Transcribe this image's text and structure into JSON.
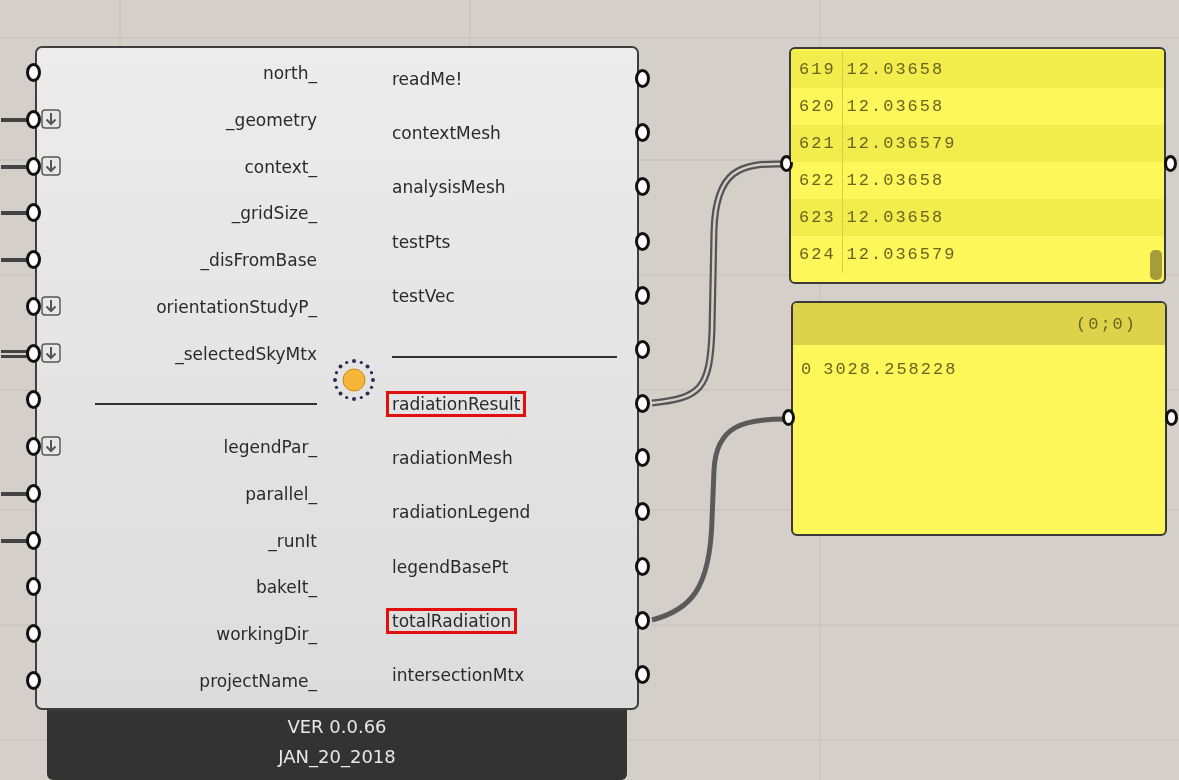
{
  "component": {
    "inputs": [
      {
        "kind": "param",
        "label": "north_",
        "flatten": false,
        "connected": false
      },
      {
        "kind": "param",
        "label": "_geometry",
        "flatten": true,
        "connected": true,
        "double_wire": false
      },
      {
        "kind": "param",
        "label": "context_",
        "flatten": true,
        "connected": true,
        "double_wire": false
      },
      {
        "kind": "param",
        "label": "_gridSize_",
        "flatten": false,
        "connected": true,
        "double_wire": false
      },
      {
        "kind": "param",
        "label": "_disFromBase",
        "flatten": false,
        "connected": true,
        "double_wire": false
      },
      {
        "kind": "param",
        "label": "orientationStudyP_",
        "flatten": true,
        "connected": false
      },
      {
        "kind": "param",
        "label": "_selectedSkyMtx",
        "flatten": true,
        "connected": true,
        "double_wire": true
      },
      {
        "kind": "divider",
        "connected": false
      },
      {
        "kind": "param",
        "label": "legendPar_",
        "flatten": true,
        "connected": false
      },
      {
        "kind": "param",
        "label": "parallel_",
        "flatten": false,
        "connected": true,
        "double_wire": false
      },
      {
        "kind": "param",
        "label": "_runIt",
        "flatten": false,
        "connected": true,
        "double_wire": false
      },
      {
        "kind": "param",
        "label": "bakeIt_",
        "flatten": false,
        "connected": false
      },
      {
        "kind": "param",
        "label": "workingDir_",
        "flatten": false,
        "connected": false
      },
      {
        "kind": "param",
        "label": "projectName_",
        "flatten": false,
        "connected": false
      }
    ],
    "outputs": [
      {
        "kind": "param",
        "label": "readMe!",
        "highlighted": false
      },
      {
        "kind": "param",
        "label": "contextMesh",
        "highlighted": false
      },
      {
        "kind": "param",
        "label": "analysisMesh",
        "highlighted": false
      },
      {
        "kind": "param",
        "label": "testPts",
        "highlighted": false
      },
      {
        "kind": "param",
        "label": "testVec",
        "highlighted": false
      },
      {
        "kind": "divider"
      },
      {
        "kind": "param",
        "label": "radiationResult",
        "highlighted": true
      },
      {
        "kind": "param",
        "label": "radiationMesh",
        "highlighted": false
      },
      {
        "kind": "param",
        "label": "radiationLegend",
        "highlighted": false
      },
      {
        "kind": "param",
        "label": "legendBasePt",
        "highlighted": false
      },
      {
        "kind": "param",
        "label": "totalRadiation",
        "highlighted": true
      },
      {
        "kind": "param",
        "label": "intersectionMtx",
        "highlighted": false
      }
    ],
    "version": "VER 0.0.66",
    "date": "JAN_20_2018"
  },
  "panels": [
    {
      "rows": [
        {
          "index": "619",
          "value": "12.03658"
        },
        {
          "index": "620",
          "value": "12.03658"
        },
        {
          "index": "621",
          "value": "12.036579"
        },
        {
          "index": "622",
          "value": "12.03658"
        },
        {
          "index": "623",
          "value": "12.03658"
        },
        {
          "index": "624",
          "value": "12.036579"
        }
      ]
    },
    {
      "path": "(0;0)",
      "rows": [
        {
          "index": "0",
          "value": "3028.258228"
        }
      ]
    }
  ]
}
